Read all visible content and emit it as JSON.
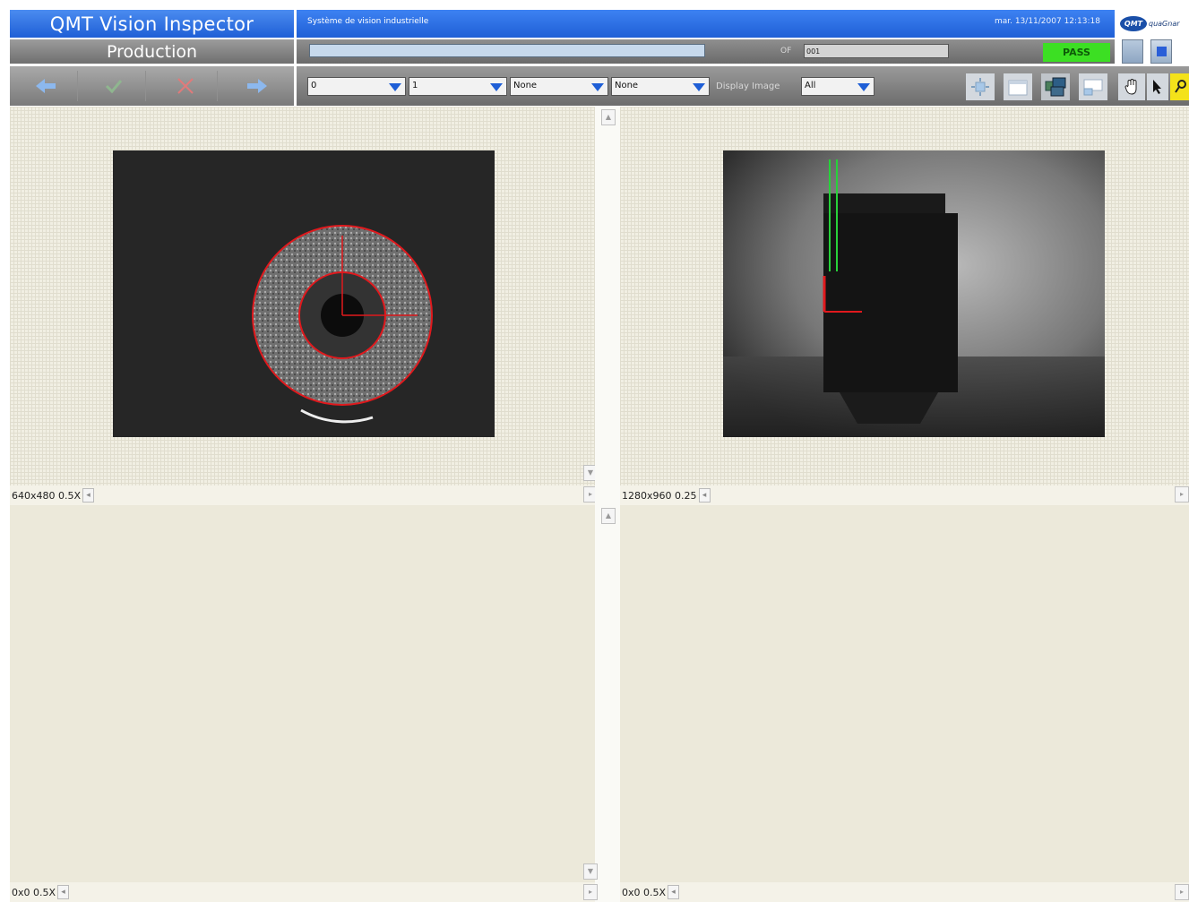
{
  "header": {
    "app_title": "QMT Vision Inspector",
    "subtitle": "Système de vision industrielle",
    "datetime": "mar. 13/11/2007 12:13:18",
    "logo_badge": "QMT",
    "logo_text": "quaGnar"
  },
  "status": {
    "mode": "Production",
    "of_label": "OF",
    "of_value": "001",
    "result": "PASS",
    "progress": 1.0
  },
  "toolbar": {
    "combo1": "0",
    "combo2": "1",
    "combo3": "None",
    "combo4": "None",
    "display_label": "Display Image",
    "display_value": "All"
  },
  "panes": [
    {
      "status": "640x480 0.5X"
    },
    {
      "status": "1280x960 0.25"
    },
    {
      "status": "0x0 0.5X"
    },
    {
      "status": "0x0 0.5X"
    }
  ],
  "colors": {
    "title_blue": "#1f5fd6",
    "pass_green": "#3cdf23",
    "overlay_red": "#e0191d",
    "overlay_green": "#27d13a"
  },
  "icons": [
    "arrow-left-icon",
    "check-icon",
    "cancel-icon",
    "arrow-right-icon",
    "zoom-fit-icon",
    "window-icon",
    "multi-window-icon",
    "layout-icon",
    "hand-icon",
    "pointer-icon",
    "zoom-icon"
  ]
}
